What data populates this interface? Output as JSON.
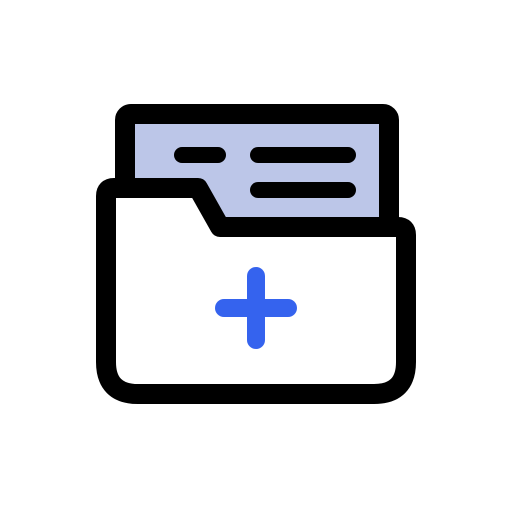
{
  "icon": {
    "name": "add-folder-icon",
    "colors": {
      "background": "#ffffff",
      "outline": "#000000",
      "document_fill": "#bcc6e8",
      "folder_fill": "#ffffff",
      "plus": "#3563ee"
    }
  }
}
